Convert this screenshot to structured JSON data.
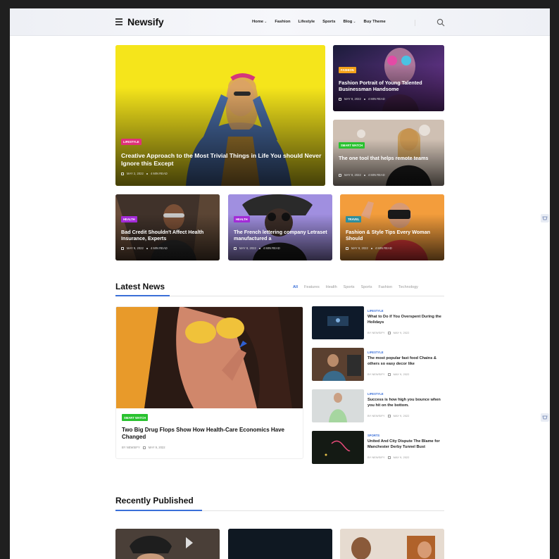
{
  "brand": {
    "name": "Newsify"
  },
  "nav": {
    "items": [
      {
        "label": "Home",
        "dropdown": true
      },
      {
        "label": "Fashion",
        "dropdown": false
      },
      {
        "label": "Lifestyle",
        "dropdown": false
      },
      {
        "label": "Sports",
        "dropdown": false
      },
      {
        "label": "Blog",
        "dropdown": true
      },
      {
        "label": "Buy Theme",
        "dropdown": false
      }
    ]
  },
  "hero": {
    "main": {
      "badge": "LIFESTYLE",
      "title": "Creative Approach to the Most Trivial Things in Life You should Never Ignore this Except",
      "date": "MAY 2, 2022",
      "read": "4 MIN READ",
      "badge_color": "#e0317a"
    },
    "side": [
      {
        "badge": "FASHION",
        "title": "Fashion Portrait of Young Talented Businessman Handsome",
        "date": "MAY 9, 2022",
        "read": "4 MIN READ",
        "badge_color": "#f4a21a"
      },
      {
        "badge": "SMART WATCH",
        "title": "The one tool that helps remote teams",
        "date": "MAY 9, 2022",
        "read": "4 MIN READ",
        "badge_color": "#29c22f"
      }
    ],
    "row": [
      {
        "badge": "HEALTH",
        "title": "Bad Credit Shouldn't Affect Health Insurance, Experts",
        "date": "MAY 9, 2022",
        "read": "4 MIN READ",
        "badge_color": "#a32bd8"
      },
      {
        "badge": "HEALTH",
        "title": "The French lettering company Letraset manufactured a",
        "date": "MAY 9, 2022",
        "read": "4 MIN READ",
        "badge_color": "#a32bd8"
      },
      {
        "badge": "TRAVEL",
        "title": "Fashion & Style Tips Every Woman Should",
        "date": "MAY 9, 2022",
        "read": "4 MIN READ",
        "badge_color": "#2f8f9e"
      }
    ]
  },
  "latest": {
    "title": "Latest News",
    "tabs": [
      "All",
      "Features",
      "Health",
      "Sports",
      "Sports",
      "Fashion",
      "Technology"
    ],
    "active_tab": "All",
    "featured": {
      "badge": "SMART WATCH",
      "title": "Two Big Drug Flops Show How Health-Care Economics Have Changed",
      "author": "BY NEWSIFY",
      "date": "MAY 9, 2022"
    },
    "items": [
      {
        "cat": "LIFESTYLE",
        "title": "What to Do if You Overspent During the Holidays",
        "author": "BY NEWSIFY",
        "date": "MAY 9, 2022"
      },
      {
        "cat": "LIFESTYLE",
        "title": "The most popular fast food Chains & others so easy decor like",
        "author": "BY NEWSIFY",
        "date": "MAY 9, 2022"
      },
      {
        "cat": "LIFESTYLE",
        "title": "Success is how high you bounce when you hit on the bottom.",
        "author": "BY NEWSIFY",
        "date": "MAY 9, 2022"
      },
      {
        "cat": "SPORTS",
        "title": "United And City Dispute The Blame for Manchester Derby Tunnel Bust",
        "author": "BY NEWSIFY",
        "date": "MAY 9, 2022"
      }
    ]
  },
  "recent": {
    "title": "Recently Published"
  },
  "colors": {
    "accent": "#3a6fd8"
  }
}
